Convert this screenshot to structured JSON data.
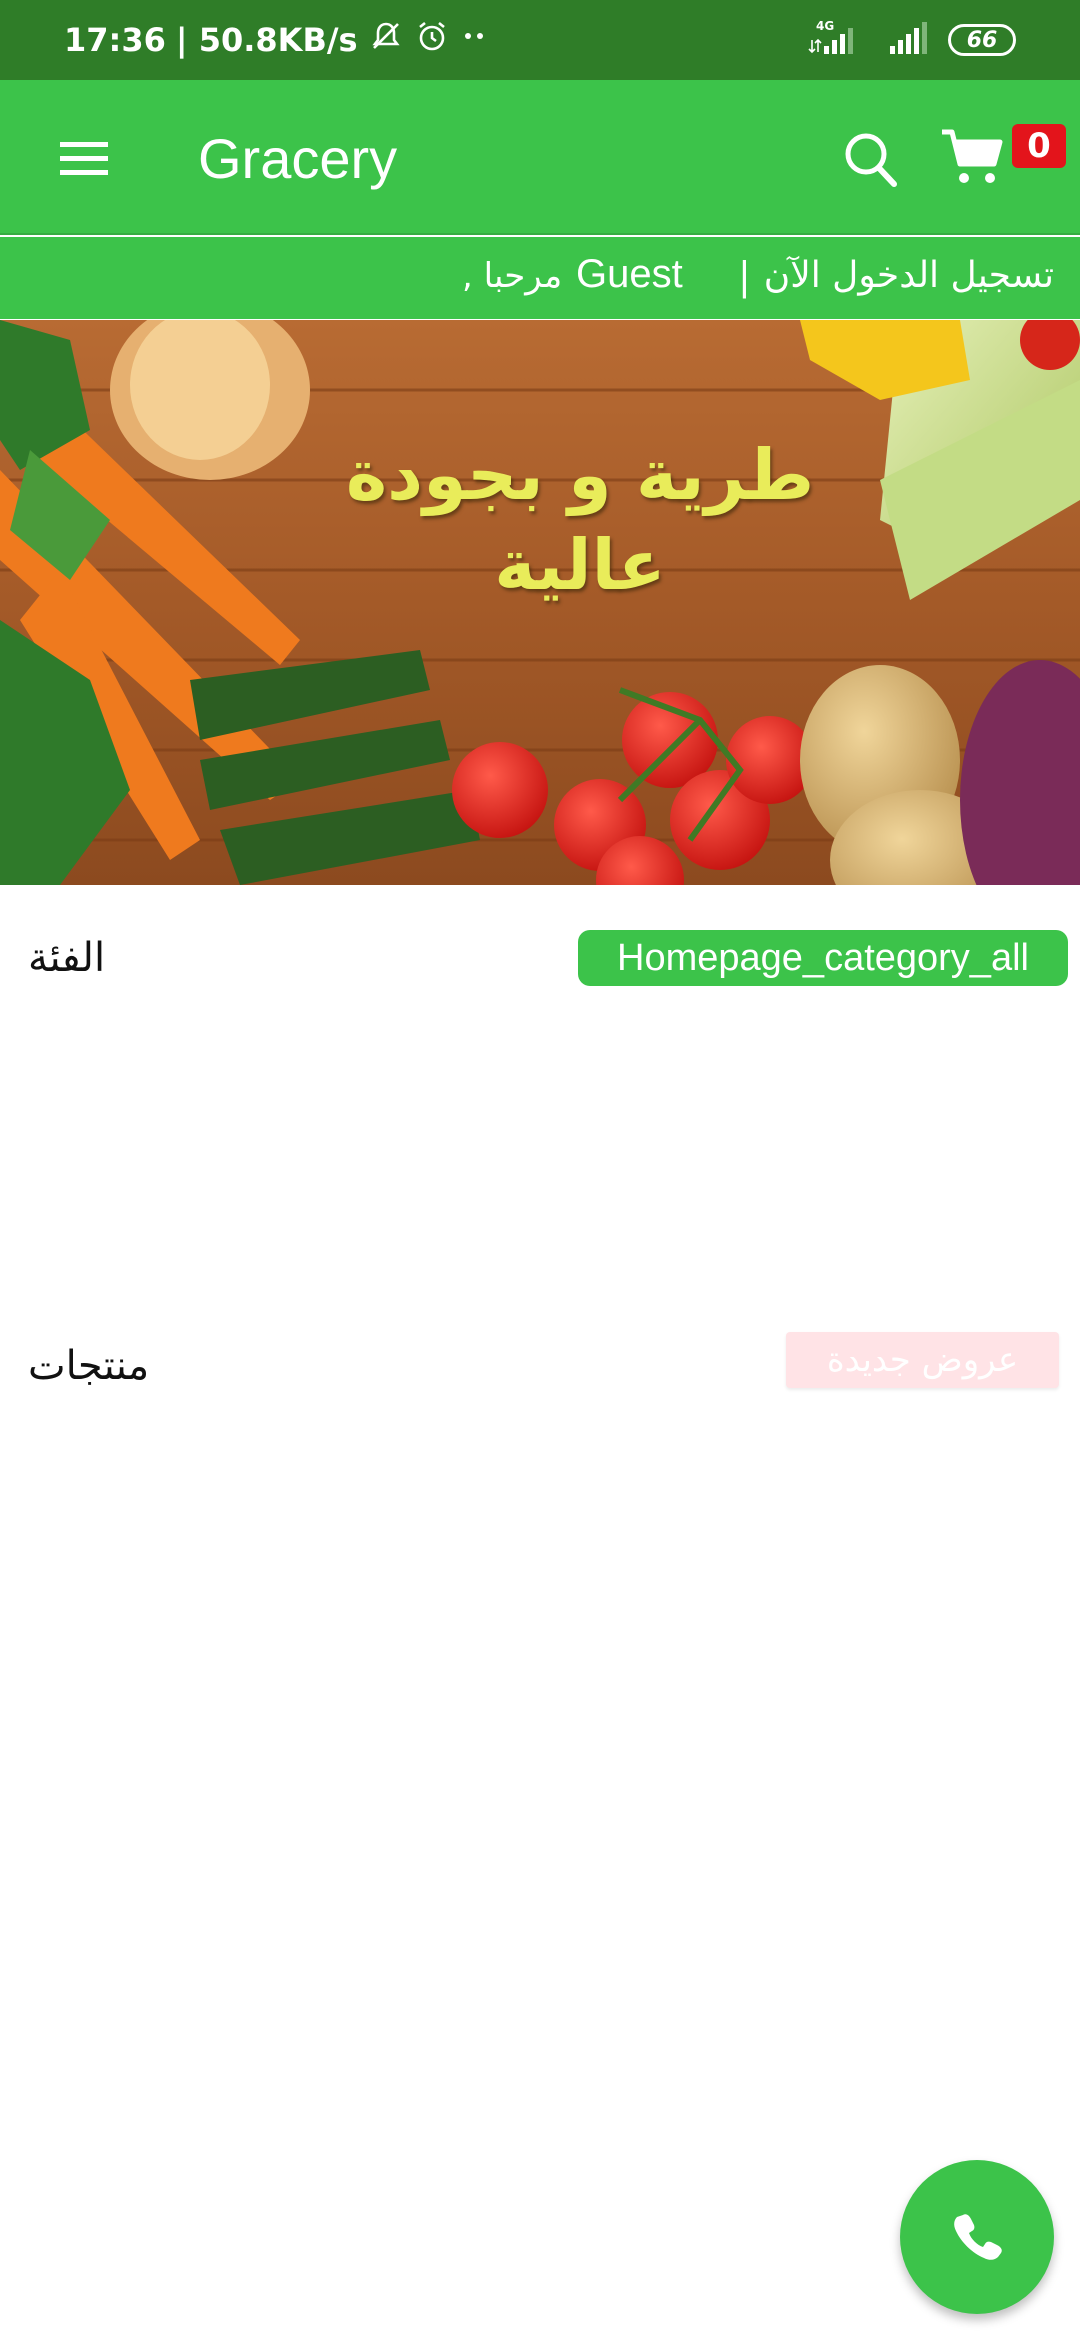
{
  "status_bar": {
    "time": "17:36",
    "speed": "| 50.8KB/s",
    "network": "4G",
    "battery": "66"
  },
  "app_bar": {
    "title": "Gracery",
    "cart_count": "0",
    "color": "#3cc34a"
  },
  "greeting": {
    "login": "تسجيل الدخول الآن",
    "separator": "|",
    "name": "Guest",
    "word": ", مرحبا"
  },
  "banner": {
    "text": "طرية و بجودة عالية"
  },
  "category": {
    "title": "الفئة",
    "all_button": "Homepage_category_all"
  },
  "products": {
    "title": "منتجات",
    "offers_button": "عروض جديدة"
  },
  "icons": {
    "menu": "menu-icon",
    "search": "search-icon",
    "cart": "cart-icon",
    "phone": "phone-icon"
  }
}
